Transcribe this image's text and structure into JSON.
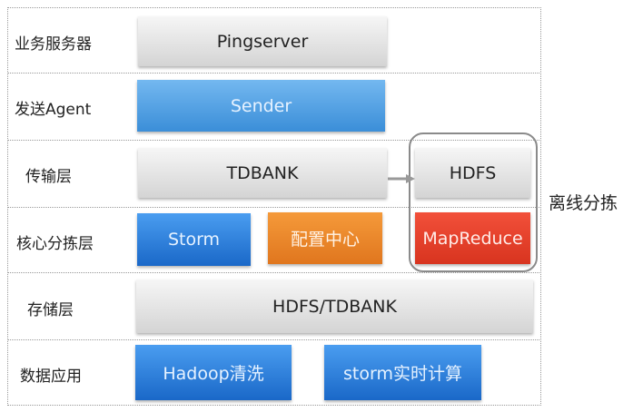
{
  "layers": [
    {
      "label": "业务服务器"
    },
    {
      "label": "发送Agent"
    },
    {
      "label": "传输层"
    },
    {
      "label": "核心分拣层"
    },
    {
      "label": "存储层"
    },
    {
      "label": "数据应用"
    }
  ],
  "boxes": {
    "pingserver": "Pingserver",
    "sender": "Sender",
    "tdbank": "TDBANK",
    "hdfs": "HDFS",
    "storm": "Storm",
    "config_center": "配置中心",
    "mapreduce": "MapReduce",
    "storage": "HDFS/TDBANK",
    "hadoop_clean": "Hadoop清洗",
    "storm_realtime": "storm实时计算"
  },
  "group_label": "离线分拣"
}
